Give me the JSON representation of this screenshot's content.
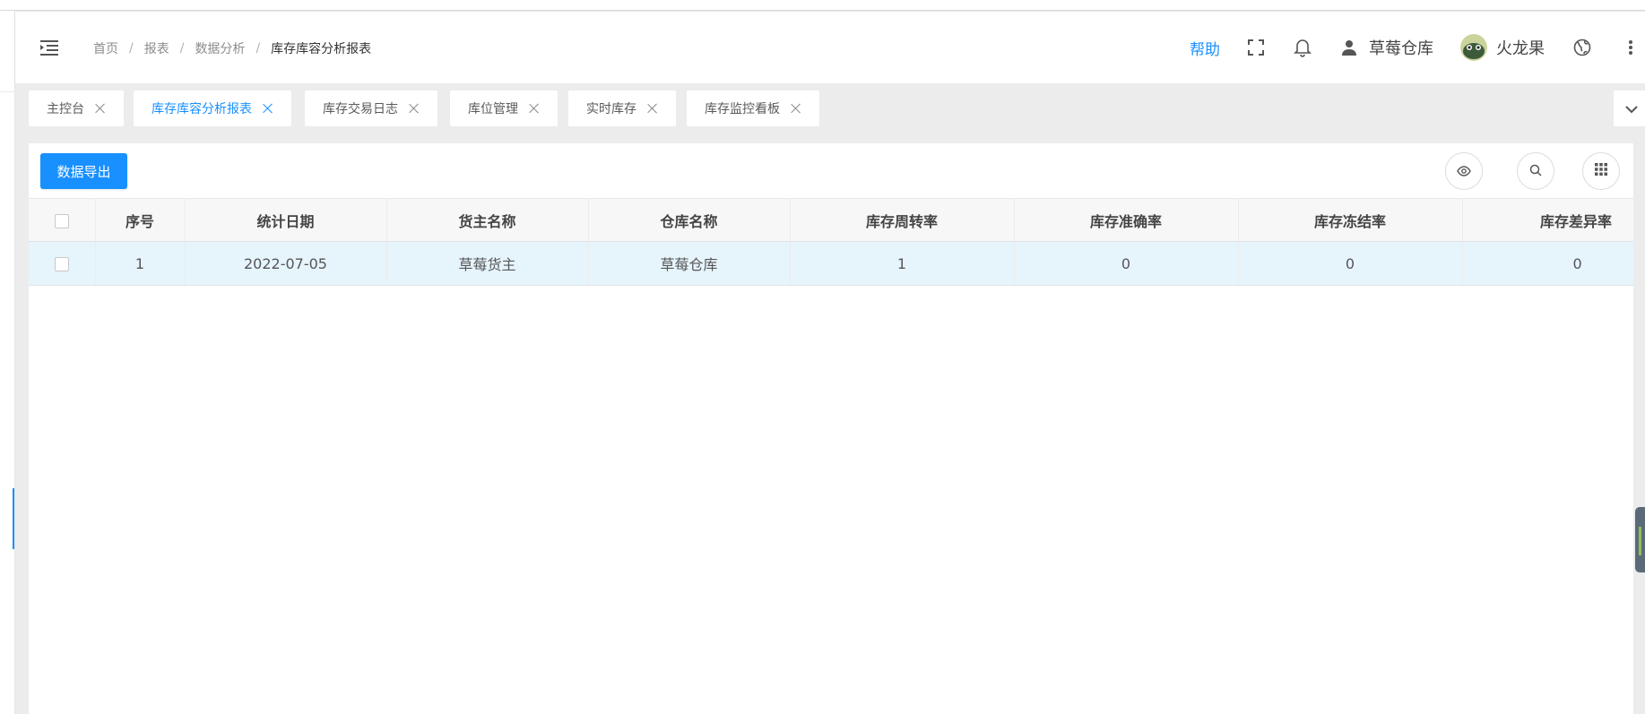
{
  "header": {
    "breadcrumb": [
      "首页",
      "报表",
      "数据分析",
      "库存库容分析报表"
    ],
    "help_label": "帮助",
    "warehouse_name": "草莓仓库",
    "user_name": "火龙果"
  },
  "tabs": [
    {
      "label": "主控台",
      "active": false
    },
    {
      "label": "库存库容分析报表",
      "active": true
    },
    {
      "label": "库存交易日志",
      "active": false
    },
    {
      "label": "库位管理",
      "active": false
    },
    {
      "label": "实时库存",
      "active": false
    },
    {
      "label": "库存监控看板",
      "active": false
    }
  ],
  "toolbar": {
    "export_label": "数据导出"
  },
  "table": {
    "columns": [
      "序号",
      "统计日期",
      "货主名称",
      "仓库名称",
      "库存周转率",
      "库存准确率",
      "库存冻结率",
      "库存差异率"
    ],
    "rows": [
      [
        "1",
        "2022-07-05",
        "草莓货主",
        "草莓仓库",
        "1",
        "0",
        "0",
        "0"
      ]
    ]
  },
  "colors": {
    "accent": "#1890ff",
    "selected_row": "#e6f4fc"
  },
  "icons": [
    "menu-fold-icon",
    "fullscreen-icon",
    "bell-icon",
    "user-icon",
    "globe-icon",
    "more-vertical-icon",
    "chevron-down-icon",
    "eye-icon",
    "search-icon",
    "grid-icon",
    "close-icon"
  ]
}
